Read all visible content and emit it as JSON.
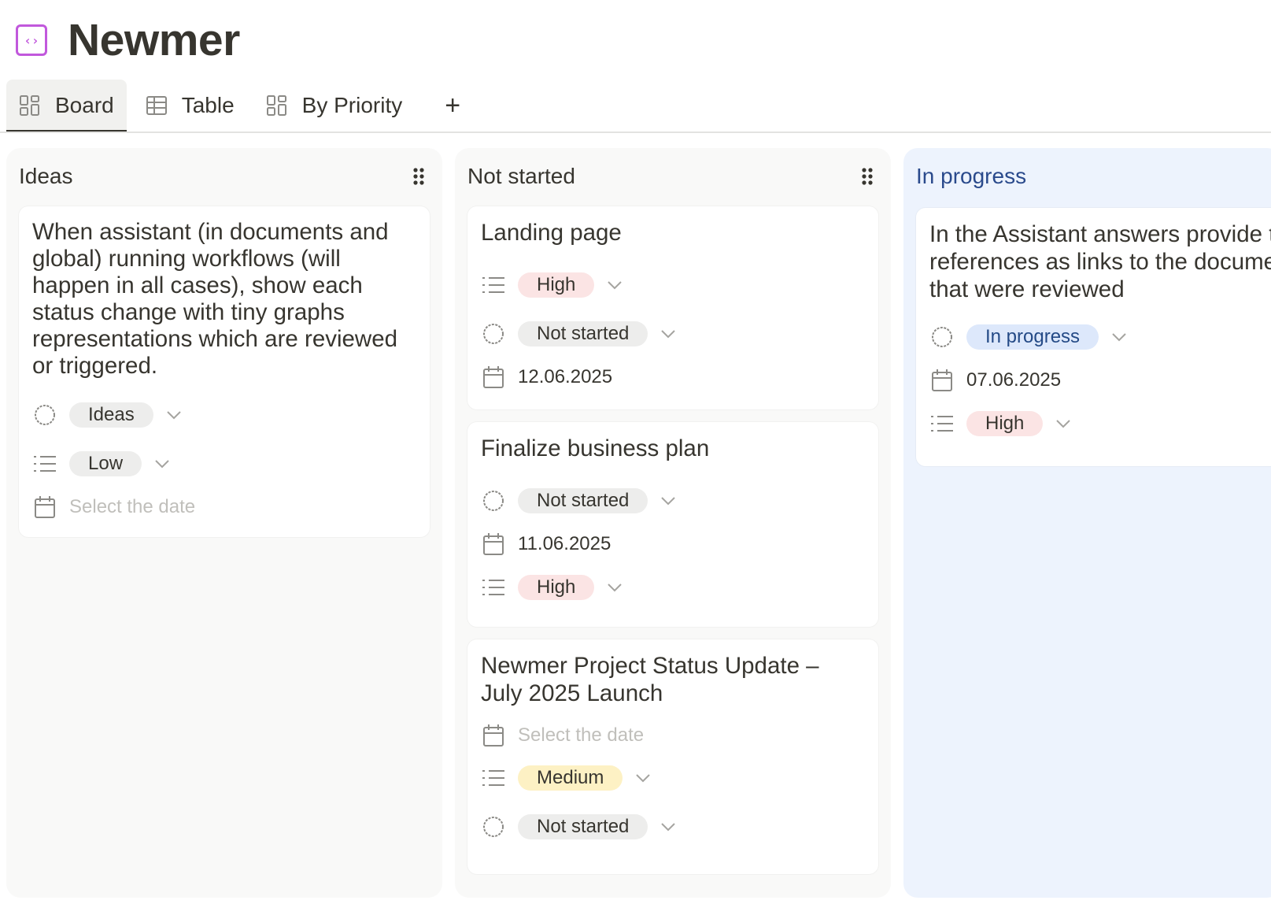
{
  "page": {
    "title": "Newmer",
    "icon": "code-icon",
    "accent": "#c158dc"
  },
  "tabs": [
    {
      "label": "Board",
      "icon": "board-icon",
      "active": true
    },
    {
      "label": "Table",
      "icon": "table-icon",
      "active": false
    },
    {
      "label": "By Priority",
      "icon": "board-icon",
      "active": false
    }
  ],
  "add_tab_label": "+",
  "columns": [
    {
      "title": "Ideas",
      "cards": [
        {
          "title": "When assistant (in documents and global) running workflows (will happen in all cases), show each status change with tiny graphs representations which are reviewed or triggered.",
          "status": "Ideas",
          "priority": "Low",
          "date": "Select the date"
        }
      ]
    },
    {
      "title": "Not started",
      "cards": [
        {
          "title": "Landing page",
          "priority": "High",
          "status": "Not started",
          "date": "12.06.2025"
        },
        {
          "title": "Finalize business plan",
          "status": "Not started",
          "date": "11.06.2025",
          "priority": "High"
        },
        {
          "title": "Newmer Project Status Update – July 2025 Launch",
          "date": "Select the date",
          "priority": "Medium",
          "status": "Not started"
        }
      ]
    },
    {
      "title": "In progress",
      "cards": [
        {
          "title": "In the Assistant answers provide the references as links to the documents that were reviewed",
          "status": "In progress",
          "date": "07.06.2025",
          "priority": "High"
        }
      ]
    }
  ],
  "colors": {
    "high": "#fbe4e4",
    "medium": "#fdf1c4",
    "in_progress_column": "#edf3fd",
    "in_progress_pill": "#dde8fb"
  }
}
